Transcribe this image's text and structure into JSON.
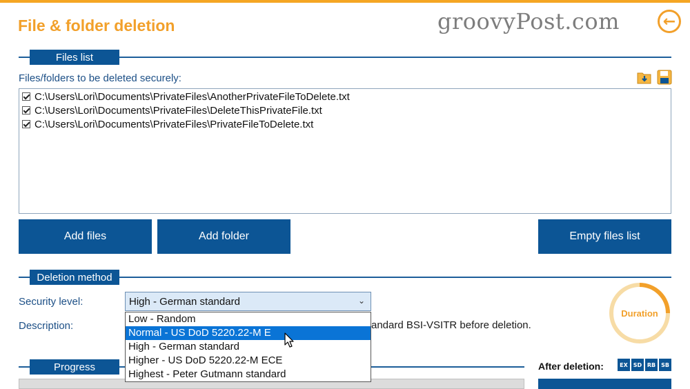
{
  "window": {
    "title": "File & folder deletion",
    "watermark": "groovyPost.com"
  },
  "files_section": {
    "tab_label": "Files list",
    "list_label": "Files/folders to be deleted securely:",
    "files": [
      {
        "checked": true,
        "path": "C:\\Users\\Lori\\Documents\\PrivateFiles\\AnotherPrivateFileToDelete.txt"
      },
      {
        "checked": true,
        "path": "C:\\Users\\Lori\\Documents\\PrivateFiles\\DeleteThisPrivateFile.txt"
      },
      {
        "checked": true,
        "path": "C:\\Users\\Lori\\Documents\\PrivateFiles\\PrivateFileToDelete.txt"
      }
    ],
    "buttons": {
      "add_files": "Add files",
      "add_folder": "Add folder",
      "empty_list": "Empty files list"
    },
    "icons": [
      "open-folder-icon",
      "save-icon"
    ]
  },
  "deletion_method": {
    "tab_label": "Deletion method",
    "security_label": "Security level:",
    "selected": "High - German standard",
    "description_label": "Description:",
    "description_visible": "andard BSI-VSITR before deletion.",
    "options": [
      "Low - Random",
      "Normal - US DoD 5220.22-M E",
      "High - German standard",
      "Higher - US DoD 5220.22-M ECE",
      "Highest - Peter Gutmann standard"
    ],
    "highlighted_index": 1,
    "duration_label": "Duration"
  },
  "progress": {
    "tab_label": "Progress",
    "after_deletion_label": "After deletion:",
    "badges": [
      "EX",
      "SD",
      "RB",
      "SB"
    ]
  },
  "colors": {
    "accent_orange": "#f2a02a",
    "primary_blue": "#0c5595",
    "dropdown_highlight": "#0a74d6"
  }
}
